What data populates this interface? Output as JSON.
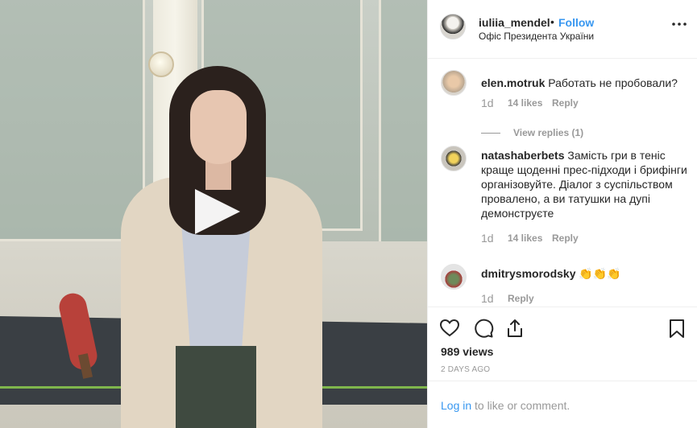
{
  "post": {
    "username": "iuliia_mendel",
    "separator": "•",
    "follow_label": "Follow",
    "location": "Офіс Президента України"
  },
  "comments": [
    {
      "username": "elen.motruk",
      "text": "Работать не пробовали?",
      "time": "1d",
      "likes": "14 likes",
      "reply": "Reply",
      "view_replies": "View replies (1)"
    },
    {
      "username": "natashaberbets",
      "text": "Замість гри в теніс краще щоденні прес-підходи і брифінги організовуйте. Діалог з суспільством провалено, а ви татушки на дупі демонструєте",
      "time": "1d",
      "likes": "14 likes",
      "reply": "Reply"
    },
    {
      "username": "dmitrysmorodsky",
      "text": "👏👏👏",
      "time": "1d",
      "reply": "Reply"
    }
  ],
  "stats": {
    "views": "989 views",
    "date": "2 DAYS AGO"
  },
  "login": {
    "link": "Log in",
    "rest": "to like or comment."
  },
  "colors": {
    "accent": "#3897f0",
    "muted": "#999999",
    "text": "#262626",
    "border": "#efefef"
  },
  "icons": [
    "play-icon",
    "more-icon",
    "heart-icon",
    "comment-icon",
    "share-icon",
    "bookmark-icon"
  ]
}
